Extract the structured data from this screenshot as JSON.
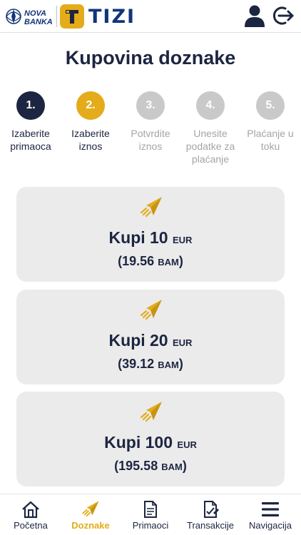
{
  "colors": {
    "navy": "#1c2541",
    "gold": "#e4ac1a",
    "grey": "#c9c9c9",
    "card": "#ebebeb"
  },
  "header": {
    "logo_nova_line1": "NOVA",
    "logo_nova_line2": "BANKA",
    "logo_tizi": "TIZI",
    "icons": [
      "user-icon",
      "logout-icon"
    ]
  },
  "page": {
    "title": "Kupovina doznake"
  },
  "steps": [
    {
      "number": "1.",
      "label": "Izaberite primaoca",
      "state": "done"
    },
    {
      "number": "2.",
      "label": "Izaberite iznos",
      "state": "active"
    },
    {
      "number": "3.",
      "label": "Potvrdite iznos",
      "state": "pending"
    },
    {
      "number": "4.",
      "label": "Unesite podatke za plaćanje",
      "state": "pending"
    },
    {
      "number": "5.",
      "label": "Plaćanje u toku",
      "state": "pending"
    }
  ],
  "cards": [
    {
      "icon": "paper-plane-icon",
      "buy": "Kupi 10",
      "currency": "EUR",
      "amount_open": "(19.56",
      "amount_currency": "BAM",
      "amount_close": ")"
    },
    {
      "icon": "paper-plane-icon",
      "buy": "Kupi 20",
      "currency": "EUR",
      "amount_open": "(39.12",
      "amount_currency": "BAM",
      "amount_close": ")"
    },
    {
      "icon": "paper-plane-icon",
      "buy": "Kupi 100",
      "currency": "EUR",
      "amount_open": "(195.58",
      "amount_currency": "BAM",
      "amount_close": ")"
    }
  ],
  "nav": [
    {
      "label": "Početna",
      "icon": "home-icon",
      "active": false
    },
    {
      "label": "Doznake",
      "icon": "paper-plane-icon",
      "active": true
    },
    {
      "label": "Primaoci",
      "icon": "document-icon",
      "active": false
    },
    {
      "label": "Transakcije",
      "icon": "transaction-doc-icon",
      "active": false
    },
    {
      "label": "Navigacija",
      "icon": "menu-icon",
      "active": false
    }
  ]
}
